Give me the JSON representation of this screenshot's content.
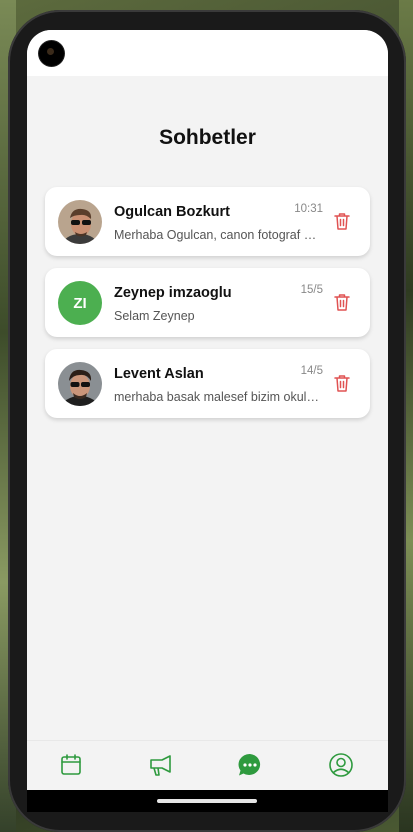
{
  "screen": {
    "title": "Sohbetler"
  },
  "chats": [
    {
      "name": "Ogulcan Bozkurt",
      "time": "10:31",
      "message": "Merhaba Ogulcan, canon fotograf makinesi hakkinda",
      "avatar": "photo-icon",
      "initials": ""
    },
    {
      "name": "Zeynep imzaoglu",
      "time": "15/5",
      "message": "Selam Zeynep",
      "avatar": "initials",
      "initials": "ZI"
    },
    {
      "name": "Levent Aslan",
      "time": "14/5",
      "message": "merhaba basak malesef bizim okulumuz",
      "avatar": "photo-icon",
      "initials": ""
    }
  ],
  "nav": {
    "items": [
      {
        "icon": "calendar-icon"
      },
      {
        "icon": "megaphone-icon"
      },
      {
        "icon": "chat-icon",
        "active": true
      },
      {
        "icon": "profile-icon"
      }
    ]
  },
  "colors": {
    "accent": "#2e9a3e",
    "delete": "#e05252",
    "avatar_bg": "#4caf50"
  }
}
